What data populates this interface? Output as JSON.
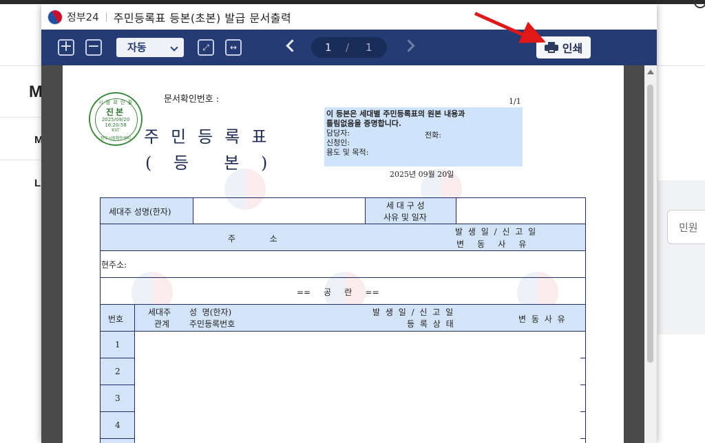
{
  "background": {
    "letters": [
      "M",
      "M",
      "L"
    ],
    "side_button": "민원"
  },
  "popup": {
    "brand": "정부24",
    "title": "주민등록표 등본(초본) 발급 문서출력",
    "toolbar": {
      "zoom_in_icon": "plus-square-icon",
      "zoom_out_icon": "minus-square-icon",
      "zoom_value": "자동",
      "fit_page_icon": "fit-page-icon",
      "fit_width_icon": "fit-width-icon",
      "page_current": "1",
      "page_separator": "/",
      "page_total": "1",
      "print_label": "인쇄"
    }
  },
  "document": {
    "seal": {
      "top": "시 점 확 인 필",
      "mark": "진본",
      "date": "2025/09/20",
      "time": "16:20:58",
      "tz": "KST",
      "org": "정부시점확인센터"
    },
    "confirm_number_label": "문서확인번호 :",
    "title": "주민등록표",
    "subtitle": "( 등  본 )",
    "page_fraction": "1/1",
    "cert_text_1": "이 등본은 세대별 주민등록표의 원본 내용과",
    "cert_text_2": "틀림없음을 증명합니다.",
    "clerk_label": "담당자:",
    "phone_label": "전화:",
    "applicant_label": "신청인:",
    "purpose_label": "용도 및 목적:",
    "issue_date": "2025년 09월 20일",
    "table": {
      "householder_label": "세대주 성명(한자)",
      "household_comp_1": "세 대 구 성",
      "household_comp_2": "사유 및 일자",
      "address_header": "주             소",
      "occur_header_1": "발 생 일  /  신 고 일",
      "occur_header_2": "변     동     사     유",
      "current_address_label": "현주소:",
      "blank_note": "==     공     란     ==",
      "col_number": "번호",
      "col_relation_1": "세대주",
      "col_relation_2": "관계",
      "col_name_1": "성  명(한자)",
      "col_name_2": "주민등록번호",
      "col_date_1": "발 생 일  /  신 고 일",
      "col_date_2": "등 록 상 태",
      "col_reason": "변 동 사 유",
      "rows": [
        "1",
        "2",
        "3",
        "4"
      ]
    }
  },
  "colors": {
    "toolbar": "#243b73",
    "cell_blue": "#d3e4f8",
    "arrow": "#e01818"
  }
}
